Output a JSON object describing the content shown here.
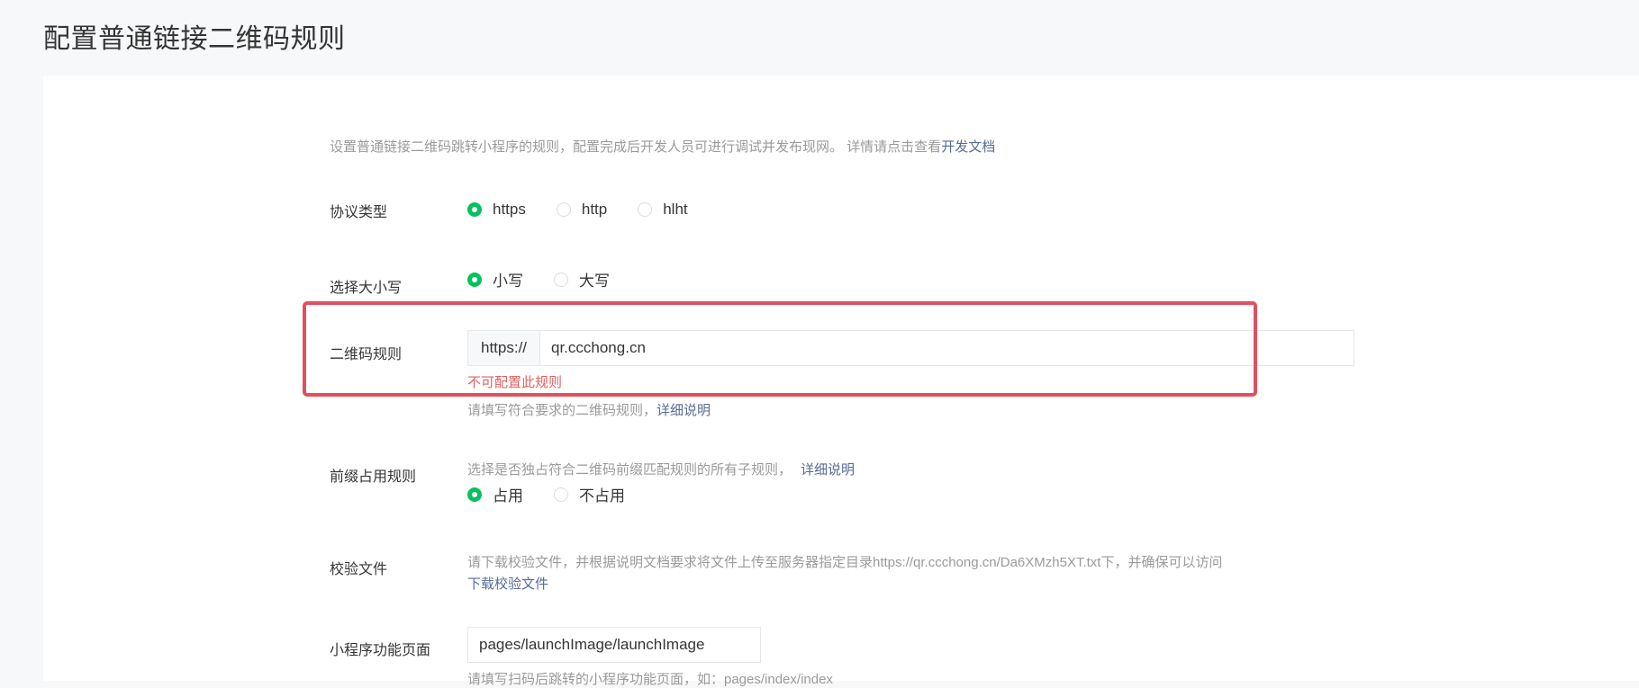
{
  "page": {
    "title": "配置普通链接二维码规则",
    "description": "设置普通链接二维码跳转小程序的规则，配置完成后开发人员可进行调试并发布现网。 详情请点击查看",
    "description_link": "开发文档"
  },
  "protocol": {
    "label": "协议类型",
    "options": [
      "https",
      "http",
      "hlht"
    ],
    "selected": "https"
  },
  "case": {
    "label": "选择大小写",
    "options": [
      "小写",
      "大写"
    ],
    "selected": "小写"
  },
  "qr_rule": {
    "label": "二维码规则",
    "prefix": "https://",
    "value": "qr.ccchong.cn",
    "error": "不可配置此规则",
    "tip": "请填写符合要求的二维码规则，",
    "tip_link": "详细说明"
  },
  "prefix_rule": {
    "label": "前缀占用规则",
    "tip": "选择是否独占符合二维码前缀匹配规则的所有子规则，",
    "tip_link": "详细说明",
    "options": [
      "占用",
      "不占用"
    ],
    "selected": "占用"
  },
  "verify_file": {
    "label": "校验文件",
    "tip": "请下载校验文件，并根据说明文档要求将文件上传至服务器指定目录https://qr.ccchong.cn/Da6XMzh5XT.txt下，并确保可以访问",
    "download_link": "下载校验文件"
  },
  "mini_page": {
    "label": "小程序功能页面",
    "value": "pages/launchImage/launchImage",
    "tip": "请填写扫码后跳转的小程序功能页面，如：pages/index/index"
  },
  "colors": {
    "accent": "#07c160",
    "error": "#e15f5f",
    "link": "#576b95",
    "highlight": "#e0505e"
  }
}
